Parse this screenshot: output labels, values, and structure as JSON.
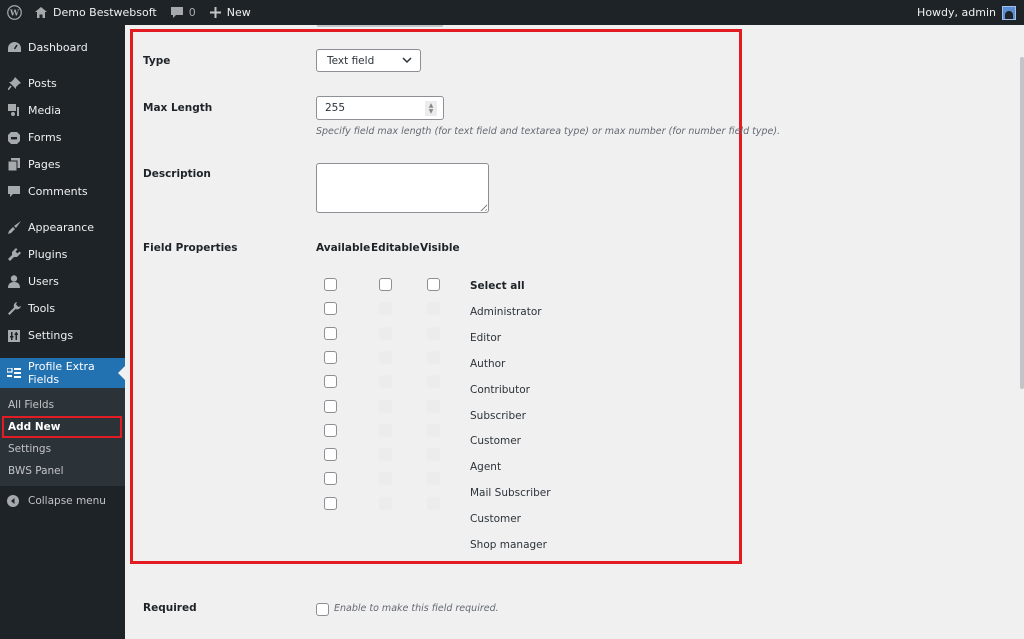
{
  "adminbar": {
    "site_name": "Demo Bestwebsoft",
    "comments_count": "0",
    "new_label": "New",
    "greeting": "Howdy, admin"
  },
  "sidebar": {
    "items": [
      {
        "label": "Dashboard",
        "icon": "dashboard-icon"
      },
      {
        "label": "Posts",
        "icon": "pin-icon"
      },
      {
        "label": "Media",
        "icon": "media-icon"
      },
      {
        "label": "Forms",
        "icon": "forms-icon"
      },
      {
        "label": "Pages",
        "icon": "pages-icon"
      },
      {
        "label": "Comments",
        "icon": "comment-icon"
      },
      {
        "label": "Appearance",
        "icon": "brush-icon"
      },
      {
        "label": "Plugins",
        "icon": "plug-icon"
      },
      {
        "label": "Users",
        "icon": "user-icon"
      },
      {
        "label": "Tools",
        "icon": "wrench-icon"
      },
      {
        "label": "Settings",
        "icon": "sliders-icon"
      },
      {
        "label": "Profile Extra Fields",
        "icon": "id-card-icon"
      }
    ],
    "submenu": [
      "All Fields",
      "Add New",
      "Settings",
      "BWS Panel"
    ],
    "collapse_label": "Collapse menu"
  },
  "form": {
    "type_label": "Type",
    "type_value": "Text field",
    "maxlength_label": "Max Length",
    "maxlength_value": "255",
    "maxlength_hint": "Specify field max length (for text field and textarea type) or max number (for number field type).",
    "description_label": "Description",
    "description_value": "",
    "field_properties_label": "Field Properties",
    "columns": [
      "Available",
      "Editable",
      "Visible"
    ],
    "select_all_label": "Select all",
    "roles": [
      "Administrator",
      "Editor",
      "Author",
      "Contributor",
      "Subscriber",
      "Customer",
      "Agent",
      "Mail Subscriber",
      "Customer",
      "Shop manager"
    ],
    "required_label": "Required",
    "required_hint": "Enable to make this field required."
  },
  "colors": {
    "highlight": "#e31b23",
    "accent": "#2271b1",
    "sidebar_bg": "#1d2327"
  }
}
